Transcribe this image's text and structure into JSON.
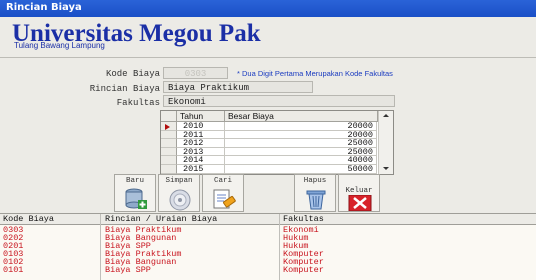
{
  "window": {
    "title": "Rincian Biaya"
  },
  "header": {
    "university": "Universitas Megou Pak",
    "location": "Tulang Bawang Lampung"
  },
  "form": {
    "kode_label": "Kode Biaya",
    "kode_value": "0303",
    "kode_note": "* Dua Digit Pertama Merupakan Kode Fakultas",
    "rincian_label": "Rincian Biaya",
    "rincian_value": "Biaya Praktikum",
    "fakultas_label": "Fakultas",
    "fakultas_value": "Ekonomi"
  },
  "grid": {
    "col_tahun": "Tahun",
    "col_besar": "Besar Biaya",
    "rows": [
      {
        "tahun": "2010",
        "besar": "20000"
      },
      {
        "tahun": "2011",
        "besar": "20000"
      },
      {
        "tahun": "2012",
        "besar": "25000"
      },
      {
        "tahun": "2013",
        "besar": "25000"
      },
      {
        "tahun": "2014",
        "besar": "40000"
      },
      {
        "tahun": "2015",
        "besar": "50000"
      }
    ]
  },
  "buttons": {
    "baru": "Baru",
    "simpan": "Simpan",
    "cari": "Cari",
    "hapus": "Hapus",
    "keluar": "Keluar"
  },
  "list": {
    "col_kode": "Kode Biaya",
    "col_rincian": "Rincian / Uraian Biaya",
    "col_fakultas": "Fakultas",
    "rows": [
      {
        "kode": "0303",
        "rincian": "Biaya Praktikum",
        "fakultas": "Ekonomi"
      },
      {
        "kode": "0202",
        "rincian": "Biaya Bangunan",
        "fakultas": "Hukum"
      },
      {
        "kode": "0201",
        "rincian": "Biaya SPP",
        "fakultas": "Hukum"
      },
      {
        "kode": "0103",
        "rincian": "Biaya Praktikum",
        "fakultas": "Komputer"
      },
      {
        "kode": "0102",
        "rincian": "Biaya Bangunan",
        "fakultas": "Komputer"
      },
      {
        "kode": "0101",
        "rincian": "Biaya SPP",
        "fakultas": "Komputer"
      }
    ]
  },
  "colors": {
    "titlebar": "#1a4fc7",
    "heading": "#1b2fa6",
    "list_text": "#c8141e",
    "row_pointer": "#b10d0d"
  }
}
